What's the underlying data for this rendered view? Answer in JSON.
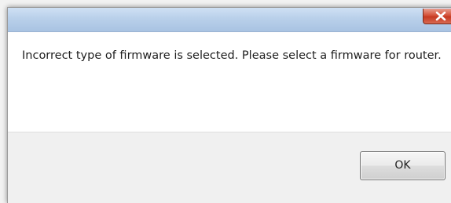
{
  "dialog": {
    "title": "",
    "message": "Incorrect type of firmware is selected. Please select a firmware for router.",
    "ok_label": "OK",
    "close_icon": "close-icon",
    "accent_close": "#c63a22",
    "titlebar_color": "#b9d0ea"
  }
}
